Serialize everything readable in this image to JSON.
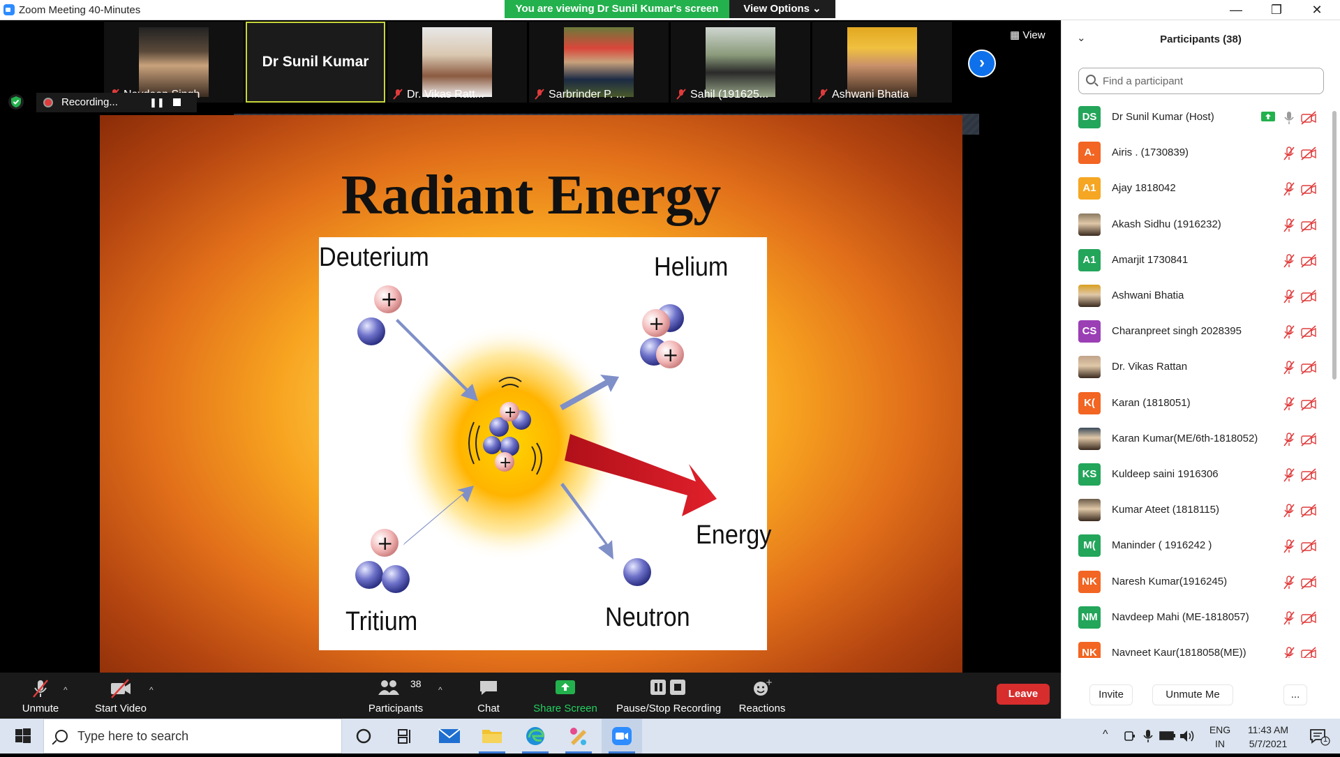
{
  "window": {
    "title": "Zoom Meeting 40-Minutes",
    "viewing_banner": "You are viewing Dr Sunil Kumar's screen",
    "view_options": "View Options",
    "minimize": "—",
    "maximize": "❐",
    "close": "✕"
  },
  "thumbnails": [
    {
      "name": "Navdeep Singh"
    },
    {
      "name": "Dr Sunil Kumar"
    },
    {
      "name": "Dr. Vikas Ratt..."
    },
    {
      "name": "Sarbrinder P. ..."
    },
    {
      "name": "Sahil (191625..."
    },
    {
      "name": "Ashwani Bhatia"
    }
  ],
  "view_button": "View",
  "recording": {
    "label": "Recording..."
  },
  "slide": {
    "title": "Radiant Energy",
    "labels": {
      "deuterium": "Deuterium",
      "helium": "Helium",
      "tritium": "Tritium",
      "neutron": "Neutron",
      "energy": "Energy"
    }
  },
  "toolbar": {
    "unmute": "Unmute",
    "start_video": "Start Video",
    "participants": "Participants",
    "participants_count": "38",
    "chat": "Chat",
    "share_screen": "Share Screen",
    "pause_stop_recording": "Pause/Stop Recording",
    "reactions": "Reactions",
    "leave": "Leave"
  },
  "panel": {
    "title": "Participants (38)",
    "search_placeholder": "Find a participant",
    "participants": [
      {
        "initials": "DS",
        "name": "Dr Sunil Kumar (Host)",
        "color": "#23a55a",
        "photo": false,
        "host": true
      },
      {
        "initials": "A.",
        "name": "Airis . (1730839)",
        "color": "#f26522",
        "photo": false
      },
      {
        "initials": "A1",
        "name": "Ajay 1818042",
        "color": "#f5a623",
        "photo": false
      },
      {
        "initials": "",
        "name": "Akash Sidhu (1916232)",
        "color": "#8a7a60",
        "photo": true
      },
      {
        "initials": "A1",
        "name": "Amarjit 1730841",
        "color": "#23a55a",
        "photo": false
      },
      {
        "initials": "",
        "name": "Ashwani Bhatia",
        "color": "#d8a020",
        "photo": true
      },
      {
        "initials": "CS",
        "name": "Charanpreet singh 2028395",
        "color": "#9b3fb5",
        "photo": false
      },
      {
        "initials": "",
        "name": "Dr. Vikas Rattan",
        "color": "#c0a38a",
        "photo": true
      },
      {
        "initials": "K(",
        "name": "Karan (1818051)",
        "color": "#f26522",
        "photo": false
      },
      {
        "initials": "",
        "name": "Karan Kumar(ME/6th-1818052)",
        "color": "#3a4a5a",
        "photo": true
      },
      {
        "initials": "KS",
        "name": "Kuldeep saini 1916306",
        "color": "#23a55a",
        "photo": false
      },
      {
        "initials": "",
        "name": "Kumar Ateet (1818115)",
        "color": "#6a5a48",
        "photo": true
      },
      {
        "initials": "M(",
        "name": "Maninder ( 1916242 )",
        "color": "#23a55a",
        "photo": false
      },
      {
        "initials": "NK",
        "name": "Naresh Kumar(1916245)",
        "color": "#f26522",
        "photo": false
      },
      {
        "initials": "NM",
        "name": "Navdeep Mahi (ME-1818057)",
        "color": "#23a55a",
        "photo": false
      },
      {
        "initials": "NK",
        "name": "Navneet Kaur(1818058(ME))",
        "color": "#f26522",
        "photo": false
      }
    ],
    "invite": "Invite",
    "unmute_me": "Unmute Me",
    "more": "..."
  },
  "taskbar": {
    "search_placeholder": "Type here to search",
    "lang": "ENG",
    "region": "IN",
    "time": "11:43 AM",
    "date": "5/7/2021",
    "notif_count": "1"
  }
}
